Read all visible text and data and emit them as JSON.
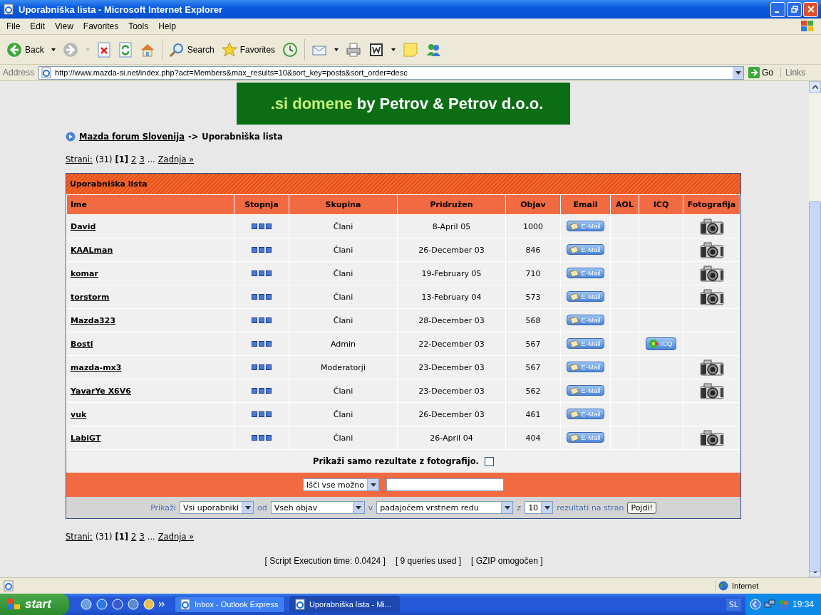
{
  "window": {
    "title": "Uporabniška lista - Microsoft Internet Explorer"
  },
  "menu": [
    "File",
    "Edit",
    "View",
    "Favorites",
    "Tools",
    "Help"
  ],
  "toolbar": {
    "back": "Back",
    "search": "Search",
    "favorites": "Favorites"
  },
  "address": {
    "label": "Address",
    "url": "http://www.mazda-si.net/index.php?act=Members&max_results=10&sort_key=posts&sort_order=desc",
    "go": "Go",
    "links": "Links"
  },
  "banner": {
    "highlight": ".si domene",
    "text": "by Petrov & Petrov d.o.o."
  },
  "breadcrumb": {
    "home": "Mazda forum Slovenija",
    "separator": "->",
    "current": "Uporabniška lista"
  },
  "pagination": {
    "label": "Strani:",
    "count": "(31)",
    "current": "[1]",
    "pages": [
      "2",
      "3"
    ],
    "ellipsis": "...",
    "last": "Zadnja »"
  },
  "table": {
    "title": "Uporabniška lista",
    "columns": [
      "Ime",
      "Stopnja",
      "Skupina",
      "Pridružen",
      "Objav",
      "Email",
      "AOL",
      "ICQ",
      "Fotografija"
    ],
    "rows": [
      {
        "name": "David",
        "group": "Člani",
        "joined": "8-April 05",
        "posts": "1000",
        "email": "E-Mail",
        "photo": true
      },
      {
        "name": "KAALman",
        "group": "Člani",
        "joined": "26-December 03",
        "posts": "846",
        "email": "E-Mail",
        "photo": true
      },
      {
        "name": "komar",
        "group": "Člani",
        "joined": "19-February 05",
        "posts": "710",
        "email": "E-Mail",
        "photo": true
      },
      {
        "name": "torstorm",
        "group": "Člani",
        "joined": "13-February 04",
        "posts": "573",
        "email": "E-Mail",
        "photo": true
      },
      {
        "name": "Mazda323",
        "group": "Člani",
        "joined": "28-December 03",
        "posts": "568",
        "email": "E-Mail",
        "photo": false
      },
      {
        "name": "Bosti",
        "group": "Admin",
        "joined": "22-December 03",
        "posts": "567",
        "email": "E-Mail",
        "icq": "ICQ",
        "photo": false
      },
      {
        "name": "mazda-mx3",
        "group": "Moderatorji",
        "joined": "23-December 03",
        "posts": "567",
        "email": "E-Mail",
        "photo": true
      },
      {
        "name": "YavarYe X6V6",
        "group": "Člani",
        "joined": "23-December 03",
        "posts": "562",
        "email": "E-Mail",
        "photo": true
      },
      {
        "name": "vuk",
        "group": "Člani",
        "joined": "26-December 03",
        "posts": "461",
        "email": "E-Mail",
        "photo": false
      },
      {
        "name": "LabiGT",
        "group": "Člani",
        "joined": "26-April 04",
        "posts": "404",
        "email": "E-Mail",
        "photo": true
      }
    ],
    "photo_filter": {
      "label": "Prikaži samo rezultate z fotografijo.",
      "checked": false
    },
    "search": {
      "scope": "Išči vse možno"
    },
    "sort": {
      "show": "Prikaži",
      "who": "Vsi uporabniki",
      "from": "od",
      "key": "Vseh objav",
      "in": "v",
      "order": "padajočem vrstnem redu",
      "z": "z",
      "count": "10",
      "per_page": "rezultati na stran",
      "submit": "Pojdi!"
    }
  },
  "pagination_bottom": {
    "label": "Strani:",
    "count": "(31)",
    "current": "[1]",
    "pages": [
      "2",
      "3"
    ],
    "ellipsis": "...",
    "last": "Zadnja »"
  },
  "stats": [
    "[ Script Execution time: 0.0424 ]",
    "[ 9 queries used ]",
    "[ GZIP omogočen ]"
  ],
  "status_bar": {
    "zone": "Internet"
  },
  "taskbar": {
    "start": "start",
    "tasks": [
      {
        "label": "Inbox - Outlook Express",
        "selected": false
      },
      {
        "label": "Uporabniška lista - Mi...",
        "selected": true
      }
    ],
    "language": "SL",
    "clock": "19:34"
  }
}
